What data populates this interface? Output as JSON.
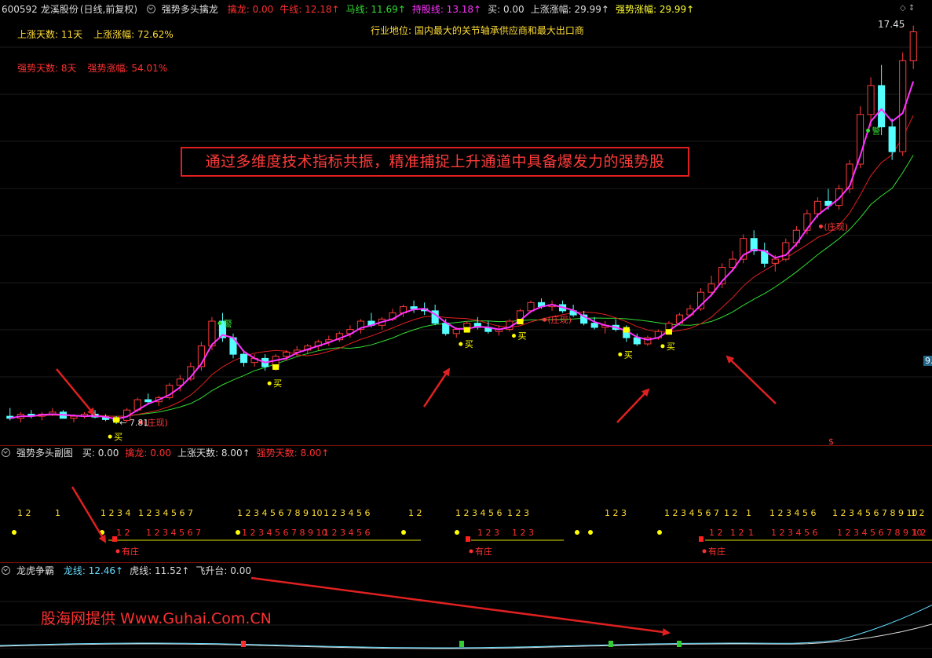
{
  "header": {
    "code": "600592",
    "name": "龙溪股份",
    "period": "(日线,前复权)",
    "indicator": "强势多头擒龙",
    "items": [
      {
        "text": "擒龙: 0.00",
        "color": "#ff3030"
      },
      {
        "text": "牛线: 12.18↑",
        "color": "#ff3030"
      },
      {
        "text": "马线: 11.69↑",
        "color": "#33dd33"
      },
      {
        "text": "持股线: 13.18↑",
        "color": "#ff33ff"
      },
      {
        "text": "买: 0.00",
        "color": "#dddddd"
      },
      {
        "text": "上涨涨幅: 29.99↑",
        "color": "#dddddd"
      },
      {
        "text": "强势涨幅: 29.99↑",
        "color": "#ffff33"
      }
    ]
  },
  "info": {
    "rise_days": "上涨天数: 11天",
    "rise_pct": "上涨涨幅: 72.62%",
    "strong_days": "强势天数: 8天",
    "strong_pct": "强势涨幅: 54.01%",
    "industry": "行业地位: 国内最大的关节轴承供应商和最大出口商"
  },
  "caption": "通过多维度技术指标共振，精准捕捉上升通道中具备爆发力的强势股",
  "price_labels": {
    "high": "17.45",
    "low": "7.81",
    "right_edge": "9."
  },
  "main_markers": {
    "buy": "买",
    "warn": "警",
    "zhuang": "(庄现)",
    "dollar": "$"
  },
  "sub1": {
    "title": "强势多头副图",
    "items": [
      {
        "text": "买: 0.00",
        "color": "#dddddd"
      },
      {
        "text": "擒龙: 0.00",
        "color": "#ff3030"
      },
      {
        "text": "上涨天数: 8.00↑",
        "color": "#dddddd"
      },
      {
        "text": "强势天数: 8.00↑",
        "color": "#ff3030"
      }
    ],
    "row_top": [
      "1 2",
      "1",
      "1 2 3 4",
      "1 2 3 4 5 6 7",
      "1 2 3 4 5 6 7 8 9 10",
      "1 2 3 4 5 6",
      "1 2",
      "1 2 3 4 5 6",
      "1 2 3",
      "1 2 3",
      "1 2 3 4 5 6 7",
      "1 2",
      "1",
      "1 2 3 4 5 6",
      "1 2 3 4 5 6 7 8 9 10",
      "1 2"
    ],
    "row_bottom": [
      "1 2",
      "1 2 3 4 5 6 7",
      "1 2 3 4 5 6 7 8 9 10",
      "1 2 3 4 5 6",
      "1 2 3",
      "1 2 3",
      "1 2",
      "1 2",
      "1",
      "1 2 3 4 5 6",
      "1 2 3 4 5 6 7 8 9 10",
      "1 2"
    ],
    "zhuang_label": "有庄"
  },
  "sub2": {
    "title": "龙虎争霸",
    "items": [
      {
        "text": "龙线: 12.46↑",
        "color": "#66ddff"
      },
      {
        "text": "虎线: 11.52↑",
        "color": "#dddddd"
      },
      {
        "text": "飞升台: 0.00",
        "color": "#dddddd"
      }
    ]
  },
  "watermark": "股海网提供 Www.Guhai.Com.CN",
  "colors": {
    "up": "#ff3b3b",
    "down": "#55ffff",
    "hold": "#ff33ff",
    "bull": "#e02020",
    "horse": "#33dd33",
    "buy": "#ffff00",
    "arrow": "#e02020"
  },
  "chart_data": {
    "type": "candlestick",
    "price_range": [
      7.81,
      17.45
    ],
    "ohlc_approx": [
      [
        8.0,
        8.2,
        7.9,
        7.95
      ],
      [
        7.95,
        8.1,
        7.85,
        8.05
      ],
      [
        8.05,
        8.15,
        7.95,
        8.0
      ],
      [
        8.0,
        8.1,
        7.9,
        8.05
      ],
      [
        8.05,
        8.2,
        8.0,
        8.1
      ],
      [
        8.1,
        8.15,
        7.95,
        7.95
      ],
      [
        7.95,
        8.05,
        7.85,
        8.0
      ],
      [
        8.0,
        8.1,
        7.95,
        8.05
      ],
      [
        8.05,
        8.15,
        7.95,
        7.98
      ],
      [
        7.98,
        8.05,
        7.88,
        7.92
      ],
      [
        7.92,
        8.0,
        7.81,
        7.9
      ],
      [
        7.9,
        8.2,
        7.85,
        8.15
      ],
      [
        8.15,
        8.45,
        8.1,
        8.4
      ],
      [
        8.4,
        8.55,
        8.3,
        8.35
      ],
      [
        8.35,
        8.5,
        8.25,
        8.45
      ],
      [
        8.45,
        8.8,
        8.4,
        8.75
      ],
      [
        8.75,
        9.0,
        8.6,
        8.9
      ],
      [
        8.9,
        9.3,
        8.85,
        9.2
      ],
      [
        9.2,
        9.8,
        9.1,
        9.7
      ],
      [
        9.7,
        10.4,
        9.6,
        10.3
      ],
      [
        10.3,
        10.5,
        9.8,
        9.9
      ],
      [
        9.9,
        10.0,
        9.4,
        9.5
      ],
      [
        9.5,
        9.6,
        9.2,
        9.3
      ],
      [
        9.3,
        9.5,
        9.2,
        9.4
      ],
      [
        9.4,
        9.5,
        9.1,
        9.2
      ],
      [
        9.2,
        9.5,
        9.1,
        9.45
      ],
      [
        9.45,
        9.6,
        9.35,
        9.55
      ],
      [
        9.55,
        9.7,
        9.45,
        9.6
      ],
      [
        9.6,
        9.75,
        9.5,
        9.7
      ],
      [
        9.7,
        9.85,
        9.6,
        9.8
      ],
      [
        9.8,
        9.95,
        9.7,
        9.85
      ],
      [
        9.85,
        10.05,
        9.8,
        10.0
      ],
      [
        10.0,
        10.2,
        9.9,
        10.1
      ],
      [
        10.1,
        10.35,
        10.0,
        10.3
      ],
      [
        10.3,
        10.5,
        10.15,
        10.2
      ],
      [
        10.2,
        10.4,
        10.1,
        10.35
      ],
      [
        10.35,
        10.6,
        10.3,
        10.5
      ],
      [
        10.5,
        10.7,
        10.4,
        10.65
      ],
      [
        10.65,
        10.8,
        10.5,
        10.6
      ],
      [
        10.6,
        10.75,
        10.45,
        10.55
      ],
      [
        10.55,
        10.7,
        10.2,
        10.25
      ],
      [
        10.25,
        10.35,
        9.95,
        10.0
      ],
      [
        10.0,
        10.15,
        9.9,
        10.1
      ],
      [
        10.1,
        10.3,
        10.05,
        10.25
      ],
      [
        10.25,
        10.4,
        10.1,
        10.15
      ],
      [
        10.15,
        10.3,
        10.0,
        10.05
      ],
      [
        10.05,
        10.2,
        9.95,
        10.1
      ],
      [
        10.1,
        10.35,
        10.05,
        10.3
      ],
      [
        10.3,
        10.6,
        10.25,
        10.55
      ],
      [
        10.55,
        10.8,
        10.5,
        10.75
      ],
      [
        10.75,
        10.85,
        10.6,
        10.65
      ],
      [
        10.65,
        10.8,
        10.55,
        10.7
      ],
      [
        10.7,
        10.8,
        10.5,
        10.55
      ],
      [
        10.55,
        10.7,
        10.4,
        10.45
      ],
      [
        10.45,
        10.55,
        10.2,
        10.25
      ],
      [
        10.25,
        10.4,
        10.1,
        10.15
      ],
      [
        10.15,
        10.3,
        10.0,
        10.2
      ],
      [
        10.2,
        10.35,
        10.05,
        10.1
      ],
      [
        10.1,
        10.2,
        9.8,
        9.9
      ],
      [
        9.9,
        10.0,
        9.7,
        9.75
      ],
      [
        9.75,
        9.95,
        9.7,
        9.9
      ],
      [
        9.9,
        10.1,
        9.85,
        10.05
      ],
      [
        10.05,
        10.3,
        10.0,
        10.25
      ],
      [
        10.25,
        10.5,
        10.2,
        10.45
      ],
      [
        10.45,
        10.7,
        10.4,
        10.6
      ],
      [
        10.6,
        11.1,
        10.55,
        11.0
      ],
      [
        11.0,
        11.4,
        10.9,
        11.2
      ],
      [
        11.2,
        11.7,
        11.1,
        11.6
      ],
      [
        11.6,
        12.0,
        11.5,
        11.8
      ],
      [
        11.8,
        12.4,
        11.7,
        12.3
      ],
      [
        12.3,
        12.5,
        11.9,
        12.0
      ],
      [
        12.0,
        12.2,
        11.6,
        11.7
      ],
      [
        11.7,
        11.9,
        11.5,
        11.8
      ],
      [
        11.8,
        12.3,
        11.75,
        12.2
      ],
      [
        12.2,
        12.6,
        12.1,
        12.5
      ],
      [
        12.5,
        13.0,
        12.4,
        12.9
      ],
      [
        12.9,
        13.3,
        12.8,
        13.2
      ],
      [
        13.2,
        13.5,
        13.0,
        13.1
      ],
      [
        13.1,
        13.6,
        13.0,
        13.5
      ],
      [
        13.5,
        14.2,
        13.4,
        14.1
      ],
      [
        14.1,
        15.5,
        14.0,
        15.3
      ],
      [
        15.3,
        16.2,
        15.0,
        16.0
      ],
      [
        16.0,
        16.5,
        14.8,
        15.0
      ],
      [
        15.0,
        15.2,
        14.2,
        14.4
      ],
      [
        14.4,
        16.8,
        14.3,
        16.6
      ],
      [
        16.6,
        17.45,
        16.4,
        17.3
      ]
    ]
  }
}
